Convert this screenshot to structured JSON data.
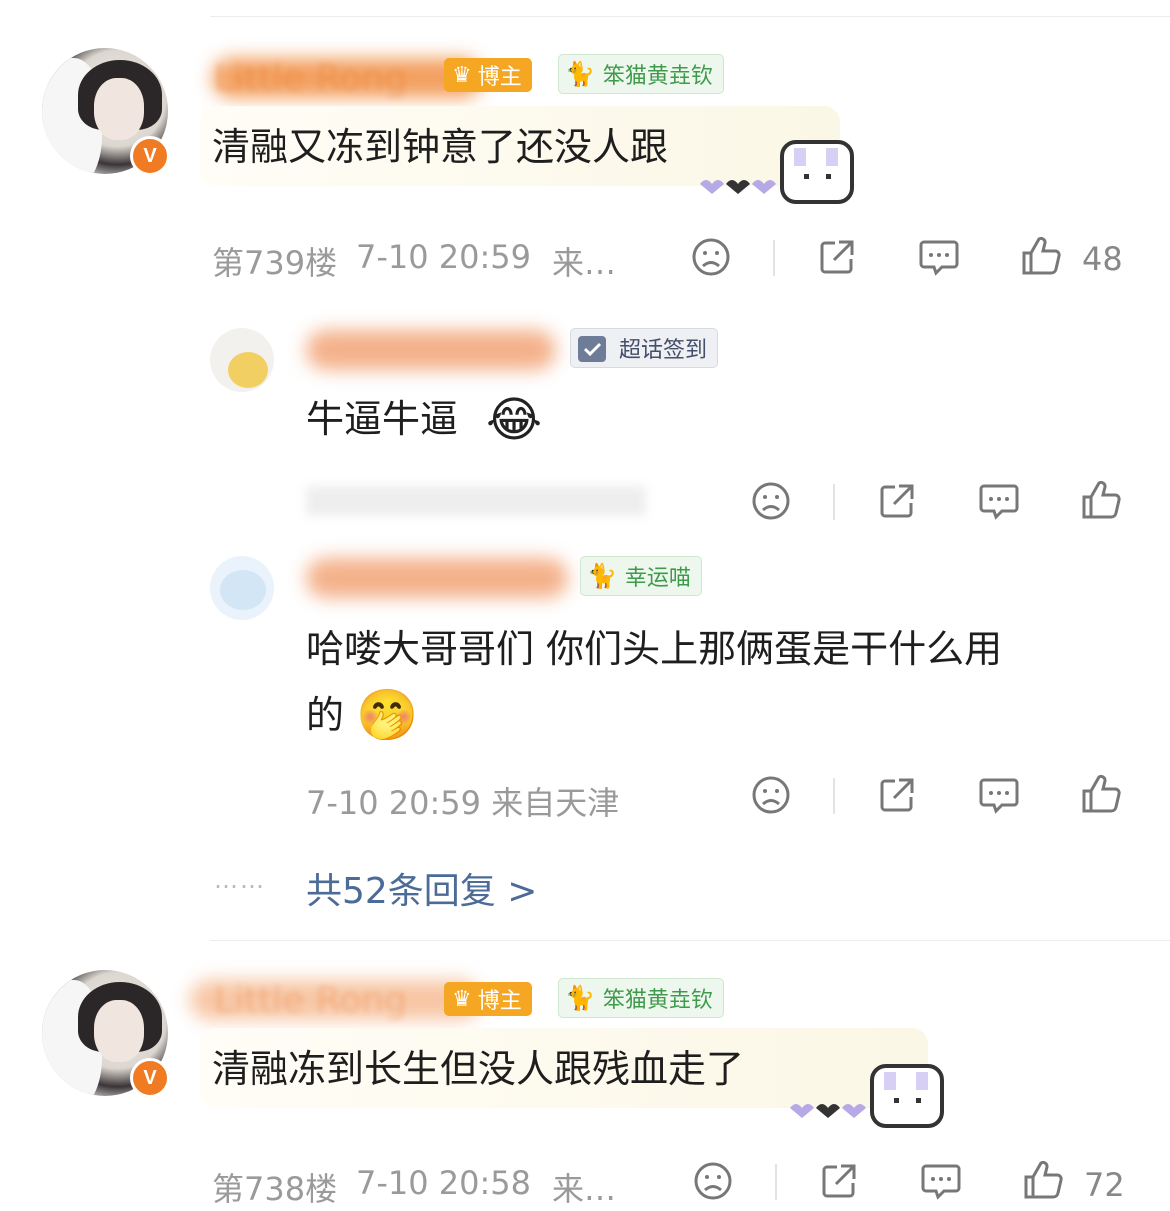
{
  "comments": [
    {
      "username": "Little Rong",
      "host_badge": "博主",
      "fan_badge": "笨猫黄垚钦",
      "text": "清融又冻到钟意了还没人跟",
      "floor": "第739楼",
      "time": "7-10 20:59",
      "location": "来…",
      "likes": "48"
    },
    {
      "username": "Little Rong",
      "host_badge": "博主",
      "fan_badge": "笨猫黄垚钦",
      "text": "清融冻到长生但没人跟残血走了",
      "floor": "第738楼",
      "time": "7-10 20:58",
      "location": "来…",
      "likes": "72"
    }
  ],
  "replies": [
    {
      "badge": "超话签到",
      "text": "牛逼牛逼",
      "emoji": "😂"
    },
    {
      "badge": "幸运喵",
      "text_line1": "哈喽大哥哥们 你们头上那俩蛋是干什么用",
      "text_line2": "的",
      "emoji": "🤭",
      "meta": "7-10 20:59 来自天津"
    }
  ],
  "reply_summary": {
    "dots": "……",
    "label": "共52条回复 >"
  },
  "colors": {
    "accent_orange": "#f07b22",
    "link_blue": "#4c6b97",
    "badge_green": "#3f9b4b"
  },
  "icons": [
    "v-badge-icon",
    "crown-icon",
    "cat-icon",
    "checkin-icon",
    "dislike-face-icon",
    "share-icon",
    "comment-icon",
    "like-thumb-icon"
  ]
}
